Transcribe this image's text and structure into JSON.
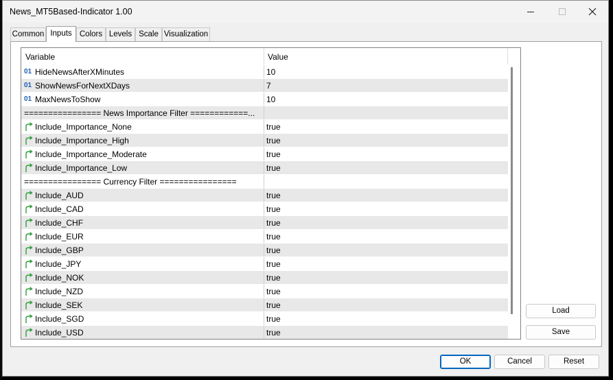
{
  "window": {
    "title": "News_MT5Based-Indicator 1.00"
  },
  "tabs": [
    {
      "label": "Common"
    },
    {
      "label": "Inputs"
    },
    {
      "label": "Colors"
    },
    {
      "label": "Levels"
    },
    {
      "label": "Scale"
    },
    {
      "label": "Visualization"
    }
  ],
  "grid": {
    "col_variable": "Variable",
    "col_value": "Value",
    "rows": [
      {
        "icon": "int-icon",
        "name": "HideNewsAfterXMinutes",
        "value": "10"
      },
      {
        "icon": "int-icon",
        "name": "ShowNewsForNextXDays",
        "value": "7"
      },
      {
        "icon": "int-icon",
        "name": "MaxNewsToShow",
        "value": "10"
      },
      {
        "icon": "",
        "name": "================ News Importance Filter ============...",
        "value": ""
      },
      {
        "icon": "bool-icon",
        "name": "Include_Importance_None",
        "value": "true"
      },
      {
        "icon": "bool-icon",
        "name": "Include_Importance_High",
        "value": "true"
      },
      {
        "icon": "bool-icon",
        "name": "Include_Importance_Moderate",
        "value": "true"
      },
      {
        "icon": "bool-icon",
        "name": "Include_Importance_Low",
        "value": "true"
      },
      {
        "icon": "",
        "name": "================ Currency Filter ================",
        "value": ""
      },
      {
        "icon": "bool-icon",
        "name": "Include_AUD",
        "value": "true"
      },
      {
        "icon": "bool-icon",
        "name": "Include_CAD",
        "value": "true"
      },
      {
        "icon": "bool-icon",
        "name": "Include_CHF",
        "value": "true"
      },
      {
        "icon": "bool-icon",
        "name": "Include_EUR",
        "value": "true"
      },
      {
        "icon": "bool-icon",
        "name": "Include_GBP",
        "value": "true"
      },
      {
        "icon": "bool-icon",
        "name": "Include_JPY",
        "value": "true"
      },
      {
        "icon": "bool-icon",
        "name": "Include_NOK",
        "value": "true"
      },
      {
        "icon": "bool-icon",
        "name": "Include_NZD",
        "value": "true"
      },
      {
        "icon": "bool-icon",
        "name": "Include_SEK",
        "value": "true"
      },
      {
        "icon": "bool-icon",
        "name": "Include_SGD",
        "value": "true"
      },
      {
        "icon": "bool-icon",
        "name": "Include_USD",
        "value": "true"
      }
    ],
    "int_icon_text": "01"
  },
  "side_buttons": {
    "load": "Load",
    "save": "Save"
  },
  "footer": {
    "ok": "OK",
    "cancel": "Cancel",
    "reset": "Reset"
  },
  "colors": {
    "accent": "#0067c0",
    "bool_icon": "#2e9e3e",
    "int_icon": "#1e5fb4"
  }
}
